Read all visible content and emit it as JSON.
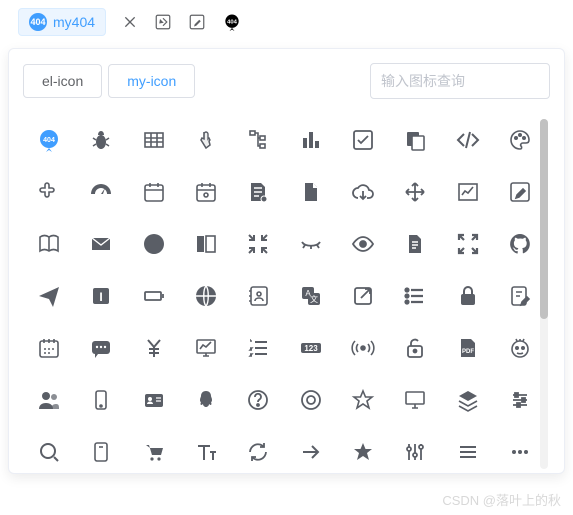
{
  "toolbar": {
    "tag_label": "my404",
    "tag_badge": "404"
  },
  "panel": {
    "tabs": [
      {
        "label": "el-icon",
        "active": false
      },
      {
        "label": "my-icon",
        "active": true
      }
    ],
    "search_placeholder": "输入图标查询"
  },
  "icons": [
    [
      "404-logo",
      "bug",
      "table",
      "drag",
      "tree",
      "barchart",
      "checkbox-checked",
      "copy",
      "code",
      "palette"
    ],
    [
      "puzzle",
      "dashboard",
      "calendar",
      "date-picker",
      "document-gear",
      "document-basic",
      "download-cloud",
      "move",
      "chart-trend",
      "edit"
    ],
    [
      "book",
      "email",
      "crosshair",
      "side-panel",
      "compress",
      "eye-closed",
      "eye-open",
      "document-text",
      "expand",
      "github"
    ],
    [
      "send",
      "text-tool",
      "battery",
      "globe",
      "contacts",
      "translate",
      "external-link",
      "list",
      "lock",
      "edit-note"
    ],
    [
      "calendar-marks",
      "message",
      "cny",
      "monitor-chart",
      "ordered-list",
      "number-123",
      "broadcast",
      "unlock",
      "pdf",
      "robot"
    ],
    [
      "users",
      "mobile",
      "id-card",
      "qq",
      "question-circle",
      "radio-off",
      "star",
      "display",
      "layers",
      "sliders"
    ],
    [
      "search",
      "device",
      "cart",
      "text-size",
      "refresh",
      "arrow-right",
      "star-filled",
      "settings-sliders",
      "menu",
      "more"
    ]
  ],
  "watermark": "CSDN @落叶上的秋"
}
